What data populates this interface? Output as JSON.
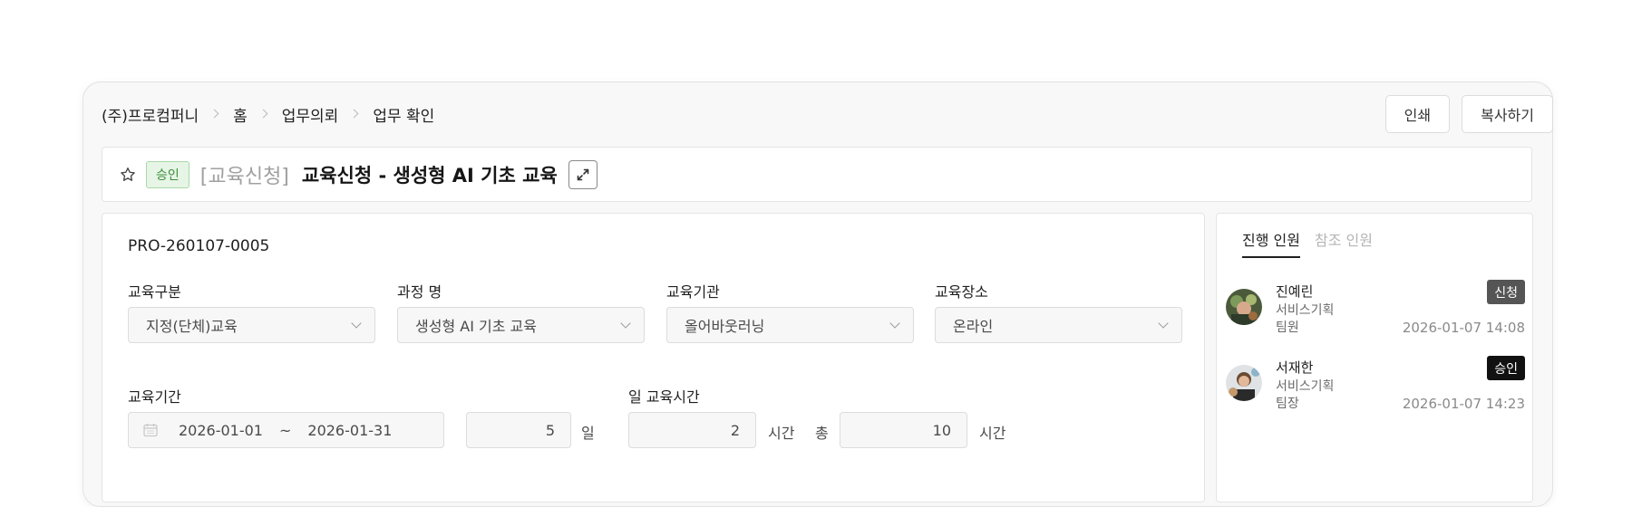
{
  "breadcrumb": [
    "(주)프로컴퍼니",
    "홈",
    "업무의뢰",
    "업무 확인"
  ],
  "actions": {
    "print": "인쇄",
    "copy": "복사하기"
  },
  "header": {
    "status_badge": "승인",
    "category": "[교육신청]",
    "title": "교육신청 - 생성형 AI 기초 교육"
  },
  "form": {
    "doc_no": "PRO-260107-0005",
    "fields": [
      {
        "label": "교육구분",
        "value": "지정(단체)교육"
      },
      {
        "label": "과정 명",
        "value": "생성형 AI 기초 교육"
      },
      {
        "label": "교육기관",
        "value": "올어바웃러닝"
      },
      {
        "label": "교육장소",
        "value": "온라인"
      }
    ],
    "period_label": "교육기간",
    "start_date": "2026-01-01",
    "tilde": "~",
    "end_date": "2026-01-31",
    "days": "5",
    "days_unit": "일",
    "daily_hours_label": "일 교육시간",
    "daily_hours": "2",
    "hours_unit": "시간",
    "total_label": "총",
    "total_hours": "10",
    "total_unit": "시간"
  },
  "side": {
    "tabs": [
      "진행 인원",
      "참조 인원"
    ],
    "people": [
      {
        "name": "진예린",
        "dept": "서비스기획",
        "role": "팀원",
        "status": "신청",
        "status_color": "#555555",
        "time": "2026-01-07  14:08"
      },
      {
        "name": "서재한",
        "dept": "서비스기획",
        "role": "팀장",
        "status": "승인",
        "status_color": "#111111",
        "time": "2026-01-07  14:23"
      }
    ]
  },
  "colors": {
    "approve_badge_bg": "#e6f5e6",
    "approve_badge_text": "#3f8f3f"
  }
}
